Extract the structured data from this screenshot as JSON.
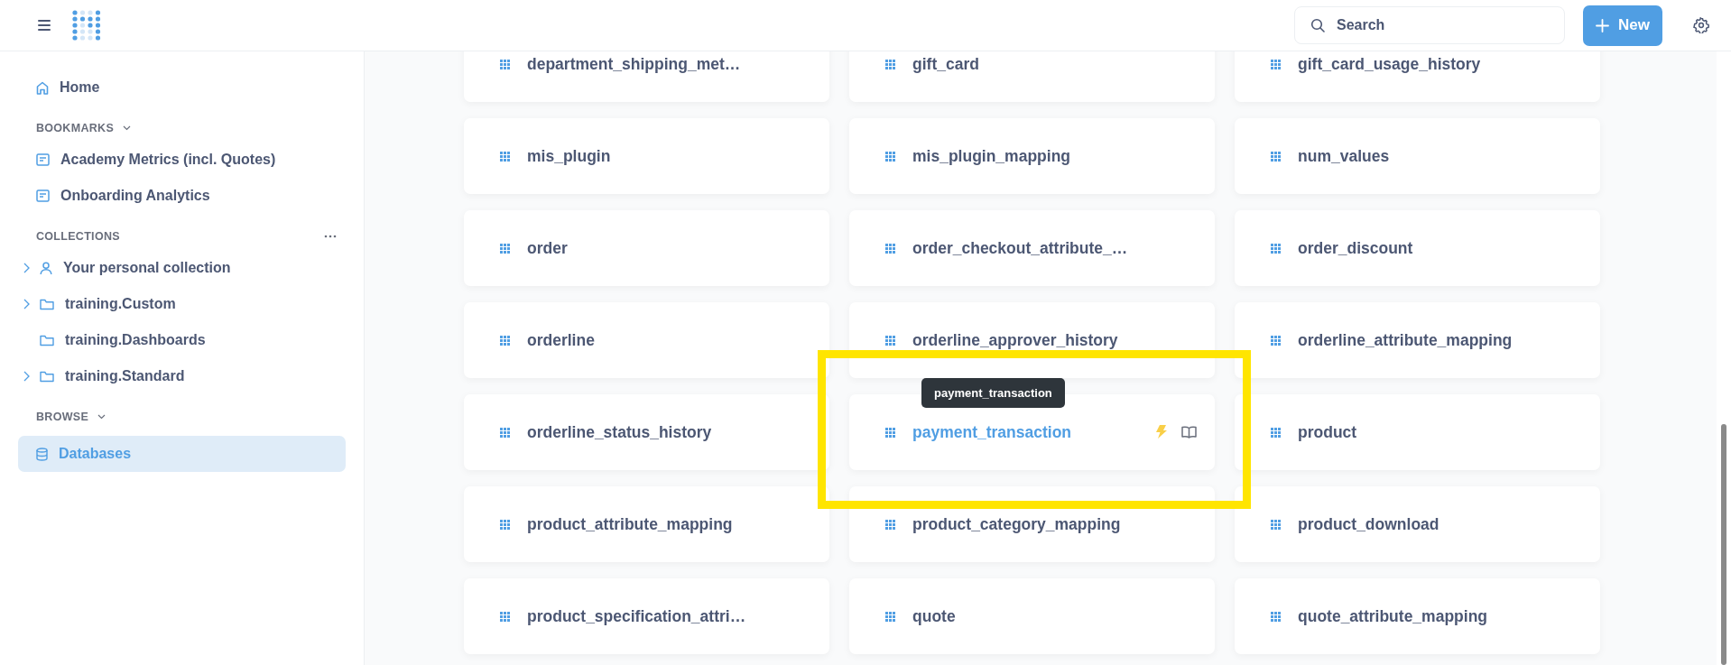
{
  "header": {
    "search": {
      "placeholder": "Search"
    },
    "new_button": "New"
  },
  "sidebar": {
    "home": {
      "label": "Home",
      "selected": false
    },
    "sections": [
      {
        "title": "BOOKMARKS",
        "kind": "bookmarks",
        "items": [
          {
            "label": "Academy Metrics (incl. Quotes)",
            "kind": "dashboard",
            "expandable": false,
            "selected": false
          },
          {
            "label": "Onboarding Analytics",
            "kind": "dashboard",
            "expandable": false,
            "selected": false
          }
        ]
      },
      {
        "title": "COLLECTIONS",
        "kind": "collections",
        "items": [
          {
            "label": "Your personal collection",
            "kind": "person",
            "expandable": true,
            "selected": false
          },
          {
            "label": "training.Custom",
            "kind": "folder",
            "expandable": true,
            "selected": false
          },
          {
            "label": "training.Dashboards",
            "kind": "folder",
            "expandable": false,
            "selected": false
          },
          {
            "label": "training.Standard",
            "kind": "folder",
            "expandable": true,
            "selected": false
          }
        ]
      },
      {
        "title": "BROWSE",
        "kind": "browse",
        "items": [
          {
            "label": "Databases",
            "kind": "database",
            "expandable": false,
            "selected": true
          }
        ]
      }
    ]
  },
  "tables": [
    {
      "name": "department_shipping_met…",
      "hovered": false
    },
    {
      "name": "gift_card",
      "hovered": false
    },
    {
      "name": "gift_card_usage_history",
      "hovered": false
    },
    {
      "name": "mis_plugin",
      "hovered": false
    },
    {
      "name": "mis_plugin_mapping",
      "hovered": false
    },
    {
      "name": "num_values",
      "hovered": false
    },
    {
      "name": "order",
      "hovered": false
    },
    {
      "name": "order_checkout_attribute_…",
      "hovered": false
    },
    {
      "name": "order_discount",
      "hovered": false
    },
    {
      "name": "orderline",
      "hovered": false
    },
    {
      "name": "orderline_approver_history",
      "hovered": false
    },
    {
      "name": "orderline_attribute_mapping",
      "hovered": false
    },
    {
      "name": "orderline_status_history",
      "hovered": false
    },
    {
      "name": "payment_transaction",
      "hovered": true
    },
    {
      "name": "product",
      "hovered": false
    },
    {
      "name": "product_attribute_mapping",
      "hovered": false
    },
    {
      "name": "product_category_mapping",
      "hovered": false
    },
    {
      "name": "product_download",
      "hovered": false
    },
    {
      "name": "product_specification_attri…",
      "hovered": false
    },
    {
      "name": "quote",
      "hovered": false
    },
    {
      "name": "quote_attribute_mapping",
      "hovered": false
    }
  ],
  "hover_tooltip": "payment_transaction",
  "highlight_frame": true
}
